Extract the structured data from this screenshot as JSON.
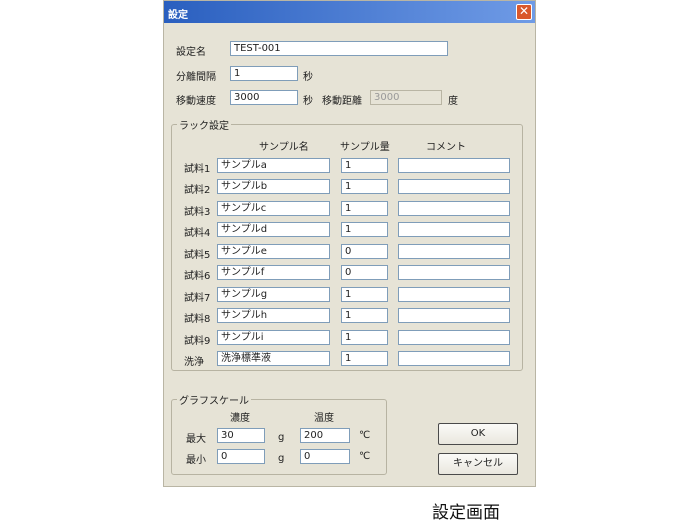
{
  "window": {
    "title": "設定",
    "close_label": "✕"
  },
  "fields": {
    "name_label": "設定名",
    "name_value": "TEST-001",
    "wait_label": "分離間隔",
    "wait_value": "1",
    "wait_unit": "秒",
    "flow_label": "移動速度",
    "flow_value": "3000",
    "flow_unit": "秒",
    "range_label": "移動距離",
    "range_value": "3000",
    "range_unit": "度"
  },
  "rack": {
    "legend": "ラック設定",
    "col_headers": [
      "サンプル名",
      "サンプル量",
      "コメント"
    ],
    "rows": [
      {
        "label": "試料1",
        "name": "サンプルa",
        "qty": "1",
        "comment": ""
      },
      {
        "label": "試料2",
        "name": "サンプルb",
        "qty": "1",
        "comment": ""
      },
      {
        "label": "試料3",
        "name": "サンプルc",
        "qty": "1",
        "comment": ""
      },
      {
        "label": "試料4",
        "name": "サンプルd",
        "qty": "1",
        "comment": ""
      },
      {
        "label": "試料5",
        "name": "サンプルe",
        "qty": "0",
        "comment": ""
      },
      {
        "label": "試料6",
        "name": "サンプルf",
        "qty": "0",
        "comment": ""
      },
      {
        "label": "試料7",
        "name": "サンプルg",
        "qty": "1",
        "comment": ""
      },
      {
        "label": "試料8",
        "name": "サンプルh",
        "qty": "1",
        "comment": ""
      },
      {
        "label": "試料9",
        "name": "サンプルi",
        "qty": "1",
        "comment": ""
      },
      {
        "label": "洗浄",
        "name": "洗浄標準液",
        "qty": "1",
        "comment": ""
      }
    ]
  },
  "scale": {
    "legend": "グラフスケール",
    "col1": "濃度",
    "col2": "温度",
    "max_label": "最大",
    "min_label": "最小",
    "max_conc": "30",
    "min_conc": "0",
    "conc_unit": "g",
    "max_temp": "200",
    "min_temp": "0",
    "temp_unit": "℃"
  },
  "buttons": {
    "ok": "OK",
    "cancel": "キャンセル"
  },
  "caption": "設定画面"
}
